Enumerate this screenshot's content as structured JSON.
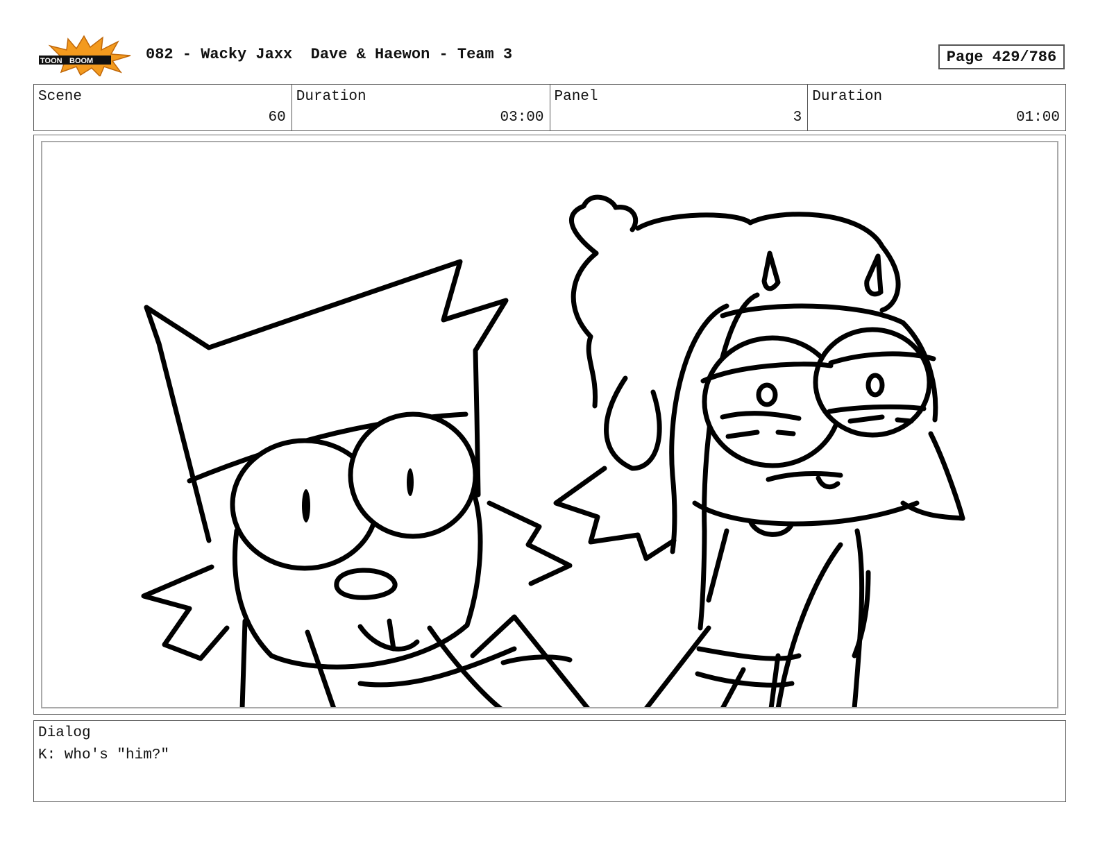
{
  "header": {
    "logo_icon": "toon-boom-logo",
    "title": "082 - Wacky Jaxx  Dave & Haewon - Team 3",
    "page": "Page 429/786"
  },
  "info": {
    "scene_label": "Scene",
    "scene_value": "60",
    "scene_duration_label": "Duration",
    "scene_duration_value": "03:00",
    "panel_label": "Panel",
    "panel_value": "3",
    "panel_duration_label": "Duration",
    "panel_duration_value": "01:00"
  },
  "panel": {
    "image_icon": "storyboard-sketch-two-characters"
  },
  "dialog": {
    "label": "Dialog",
    "text": "K: who's \"him?\""
  }
}
